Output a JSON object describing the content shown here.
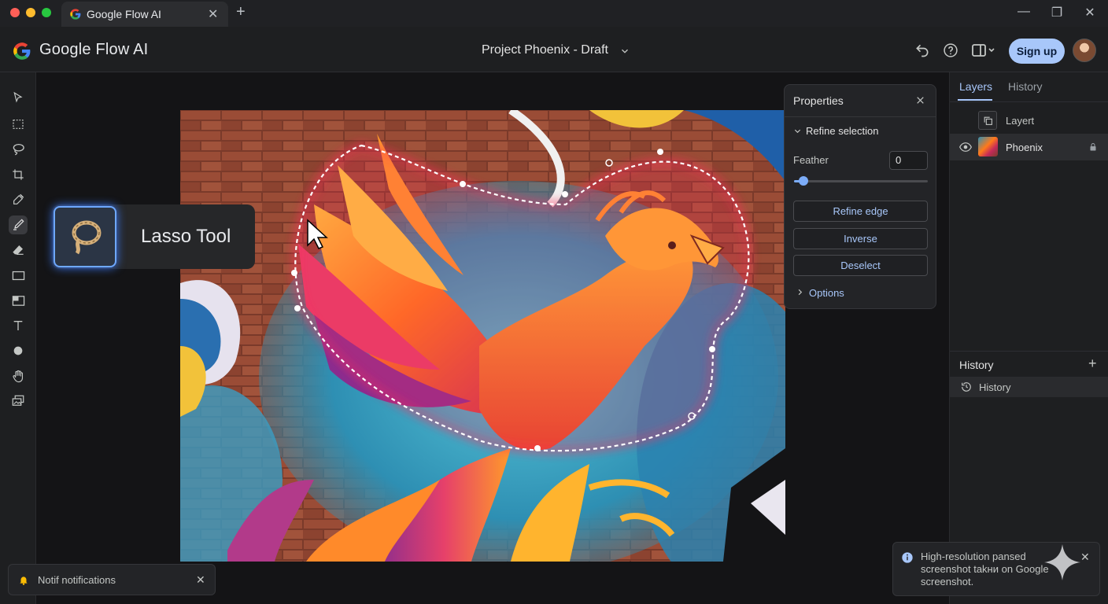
{
  "browser": {
    "tab_title": "Google Flow AI",
    "tab_close": "✕",
    "new_tab": "+",
    "window_controls": {
      "minimize": "—",
      "maximize": "❐",
      "close": "✕"
    }
  },
  "header": {
    "app_title": "Google Flow AI",
    "project_title": "Project Phoenix - Draft",
    "signup_label": "Sign up"
  },
  "tools": [
    "select-icon",
    "marquee-icon",
    "lasso-icon",
    "crop-icon",
    "eyedropper-icon",
    "brush-icon",
    "eraser-icon",
    "rectangle-icon",
    "mask-icon",
    "text-icon",
    "shape-icon",
    "hand-icon",
    "layers-stack-icon"
  ],
  "tooltip": {
    "label": "Lasso Tool"
  },
  "properties": {
    "title": "Properties",
    "refine_selection": "Refine selection",
    "feather_label": "Feather",
    "feather_value": "0",
    "feather_level": 0.07,
    "buttons": [
      "Refine edge",
      "Inverse",
      "Deselect"
    ],
    "options_label": "Options"
  },
  "right_panel": {
    "tabs": [
      "Layers",
      "History"
    ],
    "layers": [
      {
        "name": "Layert",
        "icon": "copy-icon"
      },
      {
        "name": "Phoenix",
        "icon": "image-thumbnail"
      }
    ],
    "history_title": "History",
    "history_add": "+",
    "history_items": [
      "History"
    ]
  },
  "notifications": {
    "label": "Notif notifications",
    "close": "✕"
  },
  "toast": {
    "text": "High-resolution pansed screenshot takни on Google screenshot.",
    "close": "✕"
  },
  "colors": {
    "accent": "#a8c7fa",
    "selection": "#ff2a5a",
    "glow": "#3d7dff"
  }
}
